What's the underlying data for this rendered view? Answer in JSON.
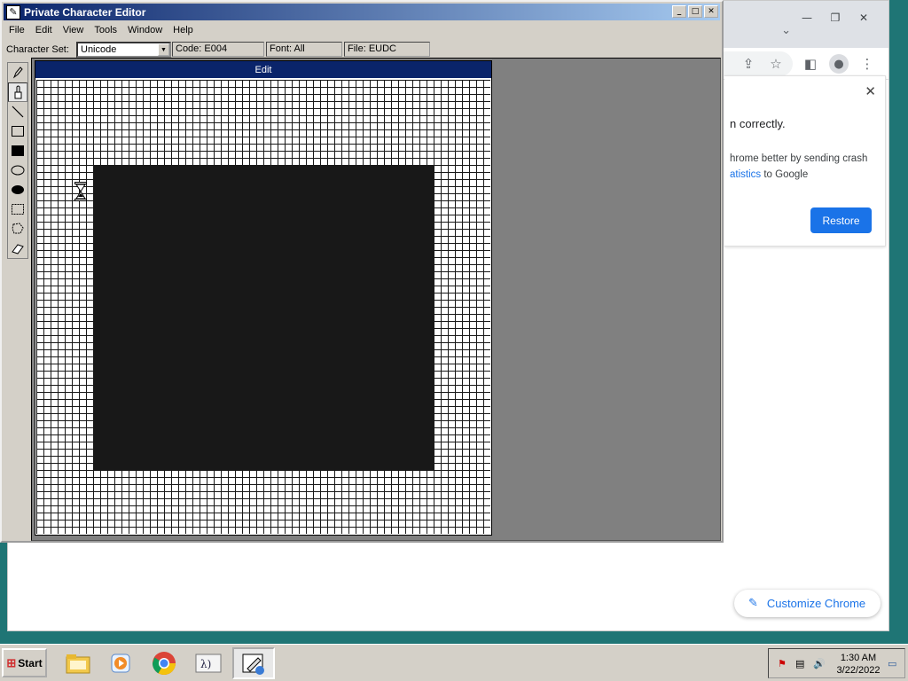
{
  "chrome": {
    "crash_title": "n correctly.",
    "crash_line1": "hrome better by sending crash",
    "crash_link": "atistics",
    "crash_line2_rest": " to Google",
    "restore_label": "Restore",
    "customize_label": "Customize Chrome"
  },
  "pce": {
    "title": "Private Character Editor",
    "menu": [
      "File",
      "Edit",
      "View",
      "Tools",
      "Window",
      "Help"
    ],
    "charset_label": "Character Set:",
    "charset_value": "Unicode",
    "code": "Code: E004",
    "font": "Font: All",
    "file": "File: EUDC",
    "edit_title": "Edit",
    "tools": [
      "pencil",
      "brush",
      "line",
      "hollow-rectangle",
      "filled-rectangle",
      "hollow-ellipse",
      "filled-ellipse",
      "rectangular-selection",
      "freeform-selection",
      "eraser"
    ],
    "active_tool": "brush"
  },
  "taskbar": {
    "start_label": "Start",
    "time": "1:30 AM",
    "date": "3/22/2022"
  }
}
